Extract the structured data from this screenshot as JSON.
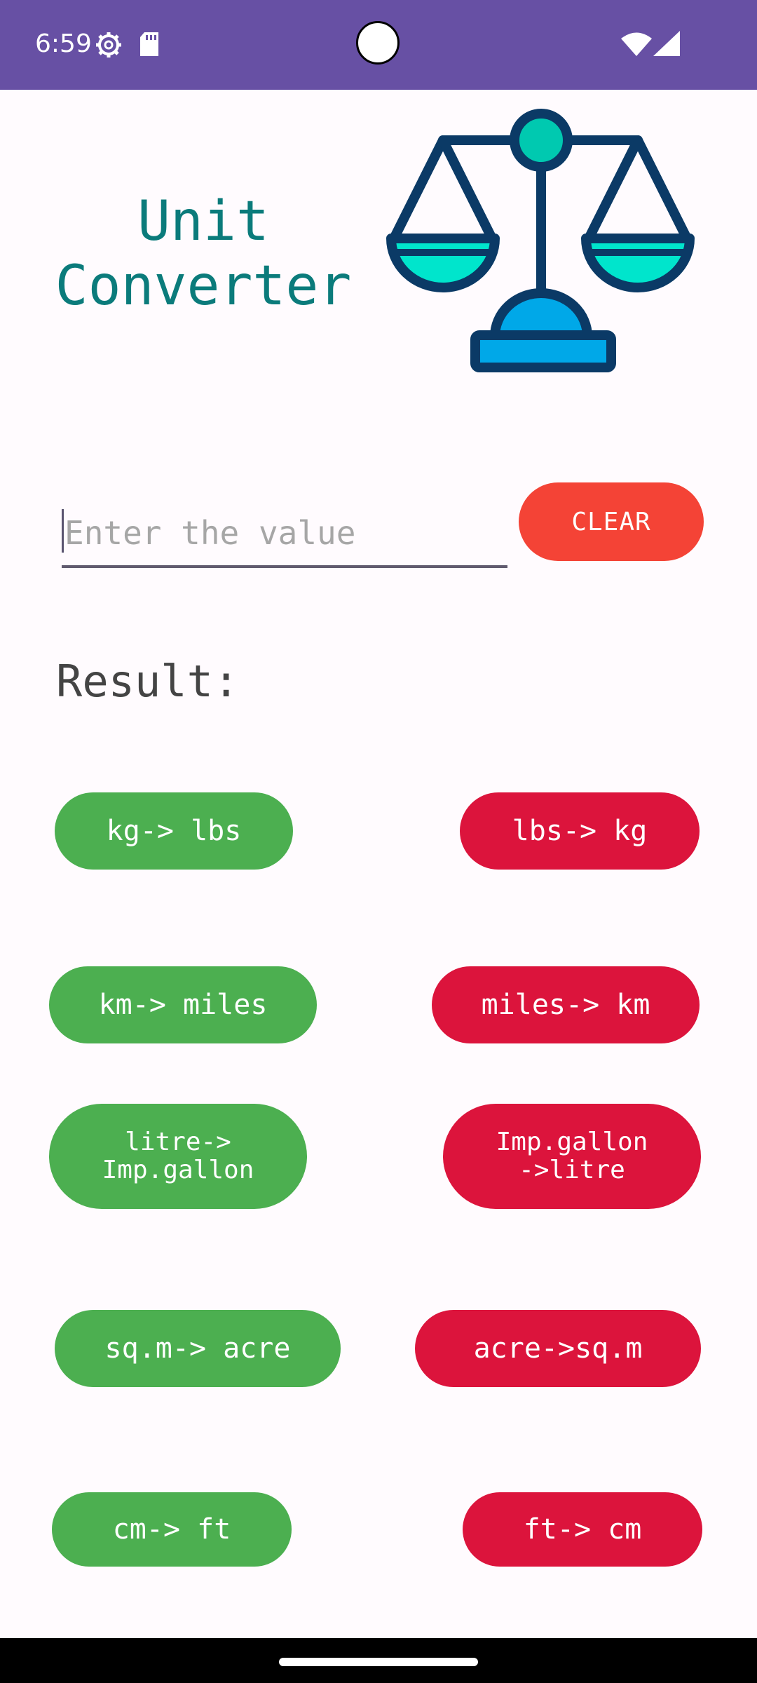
{
  "status_bar": {
    "time": "6:59",
    "icons": [
      "gear-icon",
      "sd-card-icon",
      "wifi-icon",
      "signal-icon"
    ],
    "background": "#6750a4"
  },
  "header": {
    "title": "Unit\nConverter",
    "title_color": "#0b7b7b",
    "logo": "balance-scale-icon"
  },
  "input": {
    "value": "",
    "placeholder": "Enter the value"
  },
  "clear_button": {
    "label": "CLEAR",
    "color": "#f44336"
  },
  "result": {
    "label": "Result:"
  },
  "conversions": {
    "kg_lbs": "kg-> lbs",
    "lbs_kg": "lbs-> kg",
    "km_miles": "km-> miles",
    "miles_km": "miles-> km",
    "litre_gallon": "litre->\nImp.gallon",
    "gallon_litre": "Imp.gallon\n->litre",
    "sqm_acre": "sq.m-> acre",
    "acre_sqm": "acre->sq.m",
    "cm_ft": "cm-> ft",
    "ft_cm": "ft-> cm"
  },
  "colors": {
    "green": "#4caf50",
    "red": "#dc143c"
  }
}
